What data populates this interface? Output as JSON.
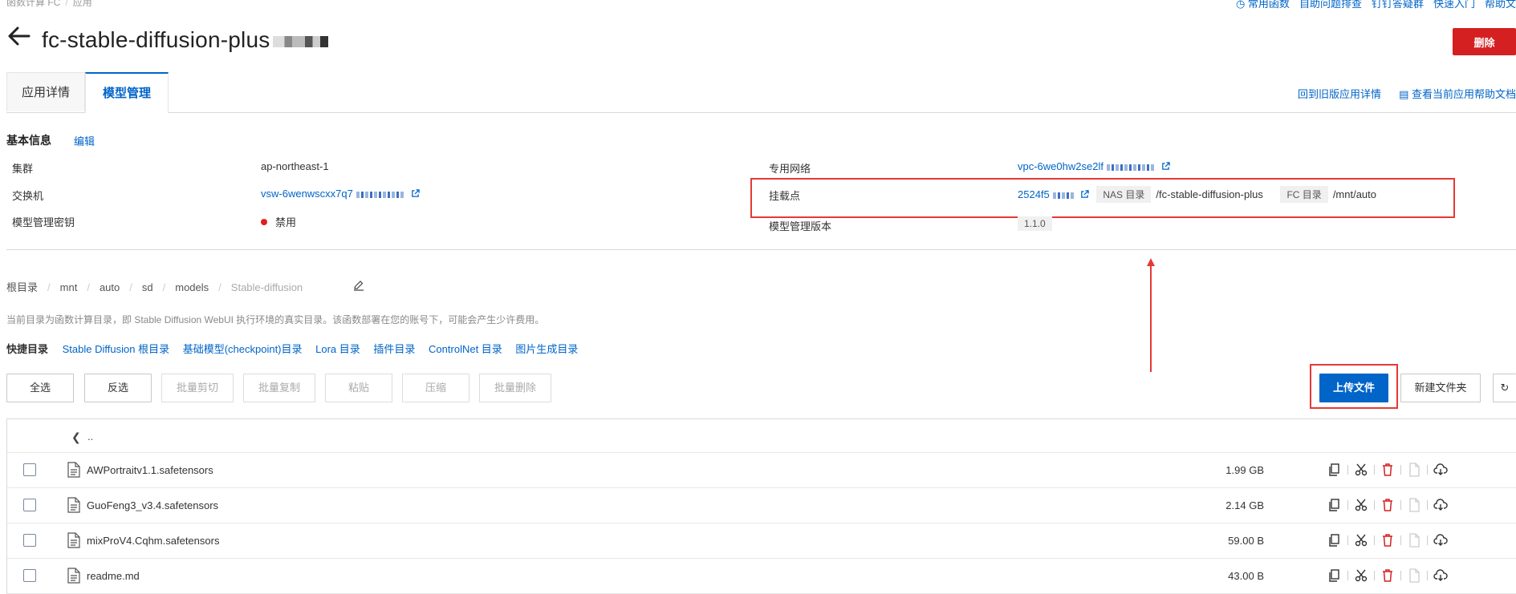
{
  "breadcrumb_top": [
    "函数计算 FC",
    "应用"
  ],
  "top_links": [
    "常用函数",
    "自助问题排查",
    "钉钉答疑群",
    "快速入门",
    "帮助文"
  ],
  "header": {
    "title": "fc-stable-diffusion-plus",
    "delete_label": "删除"
  },
  "tabs": [
    {
      "label": "应用详情"
    },
    {
      "label": "模型管理"
    }
  ],
  "tab_links": {
    "old_app": "回到旧版应用详情",
    "help_doc": "查看当前应用帮助文档"
  },
  "basic_info": {
    "title": "基本信息",
    "edit_label": "编辑",
    "cluster_label": "集群",
    "cluster_value": "ap-northeast-1",
    "vpc_label": "专用网络",
    "vpc_value": "vpc-6we0hw2se2lf",
    "switch_label": "交换机",
    "switch_value": "vsw-6wenwscxx7q7",
    "mount_label": "挂载点",
    "mount_value": "2524f5",
    "nas_dir_label": "NAS 目录",
    "nas_dir_value": "/fc-stable-diffusion-plus",
    "fc_dir_label": "FC 目录",
    "fc_dir_value": "/mnt/auto",
    "key_label": "模型管理密钥",
    "key_value": "禁用",
    "version_label": "模型管理版本",
    "version_value": "1.1.0"
  },
  "path": {
    "items": [
      "根目录",
      "mnt",
      "auto",
      "sd",
      "models"
    ],
    "current": "Stable-diffusion"
  },
  "notice": "当前目录为函数计算目录，即 Stable Diffusion WebUI 执行环境的真实目录。该函数部署在您的账号下，可能会产生少许费用。",
  "quick_dirs": {
    "title": "快捷目录",
    "items": [
      "Stable Diffusion 根目录",
      "基础模型(checkpoint)目录",
      "Lora 目录",
      "插件目录",
      "ControlNet 目录",
      "图片生成目录"
    ]
  },
  "toolbar": {
    "select_all": "全选",
    "invert": "反选",
    "batch_cut": "批量剪切",
    "batch_copy": "批量复制",
    "paste": "粘贴",
    "compress": "压缩",
    "batch_delete": "批量删除",
    "upload": "上传文件",
    "new_folder": "新建文件夹"
  },
  "table": {
    "up_label": "..",
    "files": [
      {
        "name": "AWPortraitv1.1.safetensors",
        "size": "1.99 GB"
      },
      {
        "name": "GuoFeng3_v3.4.safetensors",
        "size": "2.14 GB"
      },
      {
        "name": "mixProV4.Cqhm.safetensors",
        "size": "59.00 B"
      },
      {
        "name": "readme.md",
        "size": "43.00 B"
      }
    ]
  },
  "colors": {
    "primary": "#0064c8",
    "danger": "#d42020",
    "highlight": "#e53935"
  }
}
